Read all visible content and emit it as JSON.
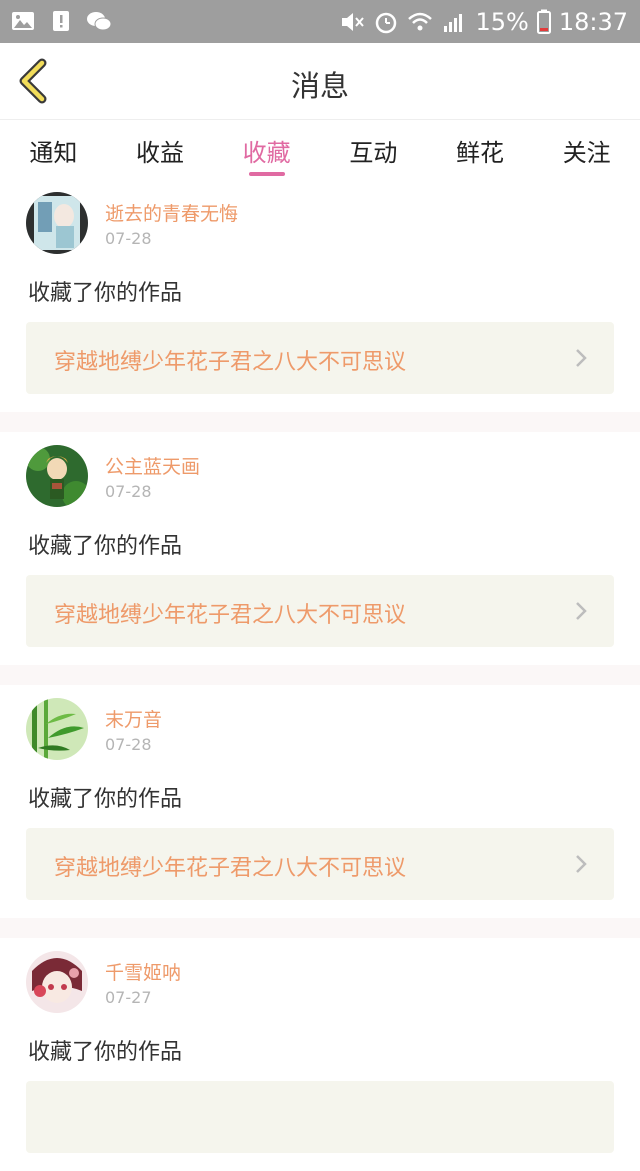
{
  "status_bar": {
    "battery_percent": "15%",
    "time": "18:37"
  },
  "header": {
    "title": "消息"
  },
  "tabs": [
    {
      "label": "通知",
      "active": false
    },
    {
      "label": "收益",
      "active": false
    },
    {
      "label": "收藏",
      "active": true
    },
    {
      "label": "互动",
      "active": false
    },
    {
      "label": "鲜花",
      "active": false
    },
    {
      "label": "关注",
      "active": false
    }
  ],
  "items": [
    {
      "username": "逝去的青春无悔",
      "date": "07-28",
      "action": "收藏了你的作品",
      "work_title": "穿越地缚少年花子君之八大不可思议"
    },
    {
      "username": "公主蓝天画",
      "date": "07-28",
      "action": "收藏了你的作品",
      "work_title": "穿越地缚少年花子君之八大不可思议"
    },
    {
      "username": "末万音",
      "date": "07-28",
      "action": "收藏了你的作品",
      "work_title": "穿越地缚少年花子君之八大不可思议"
    },
    {
      "username": "千雪姬呐",
      "date": "07-27",
      "action": "收藏了你的作品",
      "work_title": ""
    }
  ],
  "colors": {
    "accent": "#e06aa2",
    "username": "#ee9a6a",
    "status_bar": "#9e9e9e",
    "work_box": "#f5f5ed"
  }
}
